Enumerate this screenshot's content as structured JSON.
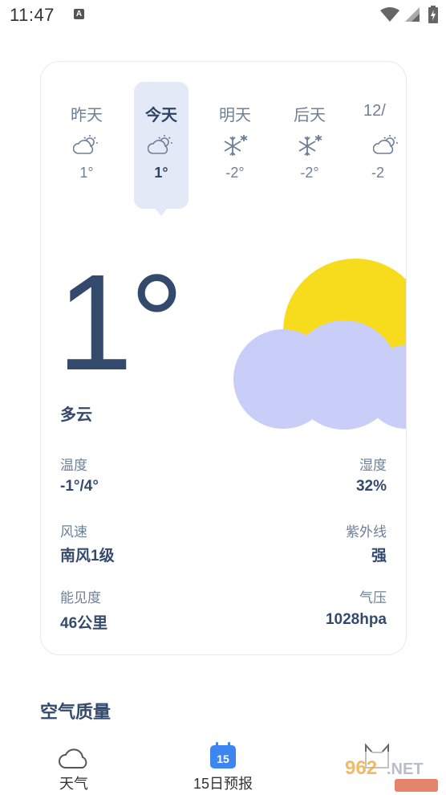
{
  "status_bar": {
    "time": "11:47",
    "notification_badge": "A"
  },
  "forecast_days": [
    {
      "label": "昨天",
      "icon": "cloudy-sun-icon",
      "temp": "1°",
      "active": false
    },
    {
      "label": "今天",
      "icon": "cloudy-sun-icon",
      "temp": "1°",
      "active": true
    },
    {
      "label": "明天",
      "icon": "snow-icon",
      "temp": "-2°",
      "active": false
    },
    {
      "label": "后天",
      "icon": "snow-icon",
      "temp": "-2°",
      "active": false
    },
    {
      "label": "12/",
      "icon": "cloudy-sun-icon",
      "temp": "-2",
      "active": false
    }
  ],
  "current": {
    "temp": "1°",
    "condition": "多云"
  },
  "metrics": {
    "temperature": {
      "label": "温度",
      "value": "-1°/4°"
    },
    "humidity": {
      "label": "湿度",
      "value": "32%"
    },
    "wind": {
      "label": "风速",
      "value": "南风1级"
    },
    "uv": {
      "label": "紫外线",
      "value": "强"
    },
    "visibility": {
      "label": "能见度",
      "value": "46公里"
    },
    "pressure": {
      "label": "气压",
      "value": "1028hpa"
    }
  },
  "air_quality": {
    "title": "空气质量"
  },
  "bottom_nav": [
    {
      "label": "天气",
      "icon": "cloud-icon"
    },
    {
      "label": "15日预报",
      "icon": "calendar-icon",
      "badge": "15"
    },
    {
      "label": "",
      "icon": "cat-icon"
    }
  ],
  "colors": {
    "sun": "#f7dc1e",
    "cloud": "#c9cef8",
    "text_primary": "#344a6c",
    "text_secondary": "#6e7f98",
    "highlight": "#e4e9f7",
    "calendar": "#3d86f0"
  }
}
